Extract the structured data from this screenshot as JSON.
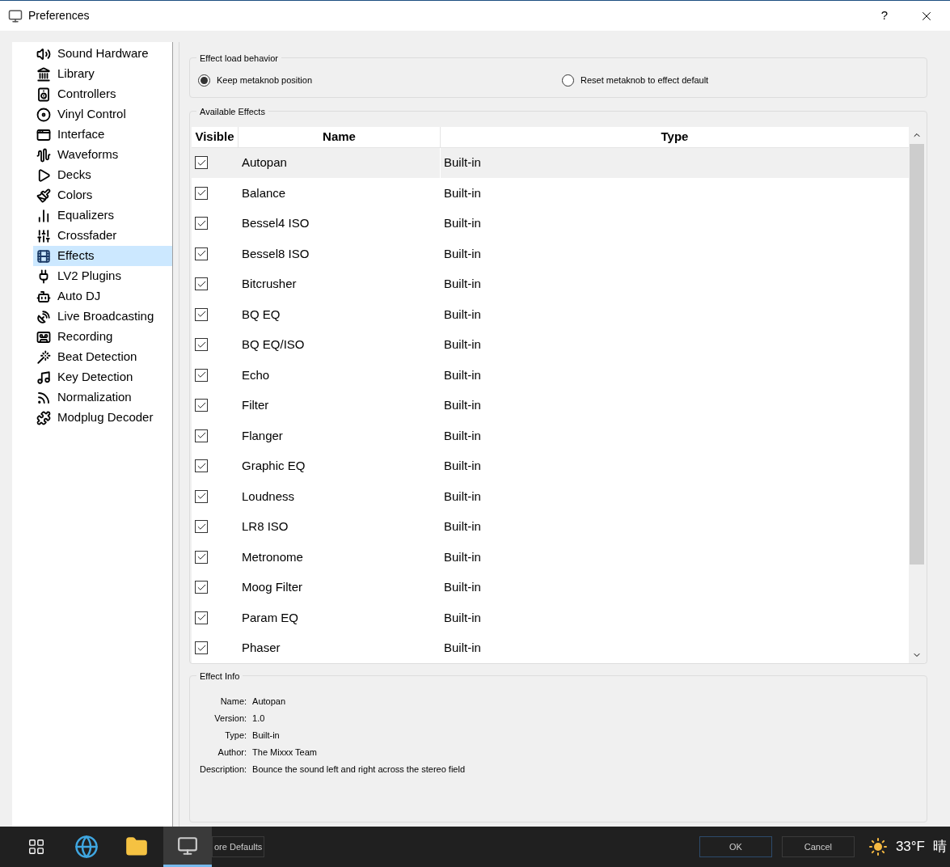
{
  "window": {
    "title": "Preferences",
    "help": "?"
  },
  "sidebar": {
    "items": [
      {
        "label": "Sound Hardware",
        "selected": false
      },
      {
        "label": "Library",
        "selected": false
      },
      {
        "label": "Controllers",
        "selected": false
      },
      {
        "label": "Vinyl Control",
        "selected": false
      },
      {
        "label": "Interface",
        "selected": false
      },
      {
        "label": "Waveforms",
        "selected": false
      },
      {
        "label": "Decks",
        "selected": false
      },
      {
        "label": "Colors",
        "selected": false
      },
      {
        "label": "Equalizers",
        "selected": false
      },
      {
        "label": "Crossfader",
        "selected": false
      },
      {
        "label": "Effects",
        "selected": true
      },
      {
        "label": "LV2 Plugins",
        "selected": false
      },
      {
        "label": "Auto DJ",
        "selected": false
      },
      {
        "label": "Live Broadcasting",
        "selected": false
      },
      {
        "label": "Recording",
        "selected": false
      },
      {
        "label": "Beat Detection",
        "selected": false
      },
      {
        "label": "Key Detection",
        "selected": false
      },
      {
        "label": "Normalization",
        "selected": false
      },
      {
        "label": "Modplug Decoder",
        "selected": false
      }
    ]
  },
  "load_behavior": {
    "title": "Effect load behavior",
    "options": [
      {
        "label": "Keep metaknob position",
        "selected": true
      },
      {
        "label": "Reset metaknob to effect default",
        "selected": false
      }
    ]
  },
  "available_effects": {
    "title": "Available Effects",
    "columns": [
      "Visible",
      "Name",
      "Type"
    ],
    "rows": [
      {
        "name": "Autopan",
        "type": "Built-in",
        "visible": true,
        "selected": true
      },
      {
        "name": "Balance",
        "type": "Built-in",
        "visible": true,
        "selected": false
      },
      {
        "name": "Bessel4 ISO",
        "type": "Built-in",
        "visible": true,
        "selected": false
      },
      {
        "name": "Bessel8 ISO",
        "type": "Built-in",
        "visible": true,
        "selected": false
      },
      {
        "name": "Bitcrusher",
        "type": "Built-in",
        "visible": true,
        "selected": false
      },
      {
        "name": "BQ EQ",
        "type": "Built-in",
        "visible": true,
        "selected": false
      },
      {
        "name": "BQ EQ/ISO",
        "type": "Built-in",
        "visible": true,
        "selected": false
      },
      {
        "name": "Echo",
        "type": "Built-in",
        "visible": true,
        "selected": false
      },
      {
        "name": "Filter",
        "type": "Built-in",
        "visible": true,
        "selected": false
      },
      {
        "name": "Flanger",
        "type": "Built-in",
        "visible": true,
        "selected": false
      },
      {
        "name": "Graphic EQ",
        "type": "Built-in",
        "visible": true,
        "selected": false
      },
      {
        "name": "Loudness",
        "type": "Built-in",
        "visible": true,
        "selected": false
      },
      {
        "name": "LR8 ISO",
        "type": "Built-in",
        "visible": true,
        "selected": false
      },
      {
        "name": "Metronome",
        "type": "Built-in",
        "visible": true,
        "selected": false
      },
      {
        "name": "Moog Filter",
        "type": "Built-in",
        "visible": true,
        "selected": false
      },
      {
        "name": "Param EQ",
        "type": "Built-in",
        "visible": true,
        "selected": false
      },
      {
        "name": "Phaser",
        "type": "Built-in",
        "visible": true,
        "selected": false
      }
    ]
  },
  "effect_info": {
    "title": "Effect Info",
    "fields": [
      {
        "label": "Name:",
        "value": "Autopan"
      },
      {
        "label": "Version:",
        "value": "1.0"
      },
      {
        "label": "Type:",
        "value": "Built-in"
      },
      {
        "label": "Author:",
        "value": "The Mixxx Team"
      },
      {
        "label": "Description:",
        "value": "Bounce the sound left and right across the stereo field"
      }
    ]
  },
  "dialog_buttons": [
    "ore Defaults",
    "OK",
    "Cancel"
  ],
  "taskbar": {
    "weather": "33°F",
    "condition": "晴"
  }
}
